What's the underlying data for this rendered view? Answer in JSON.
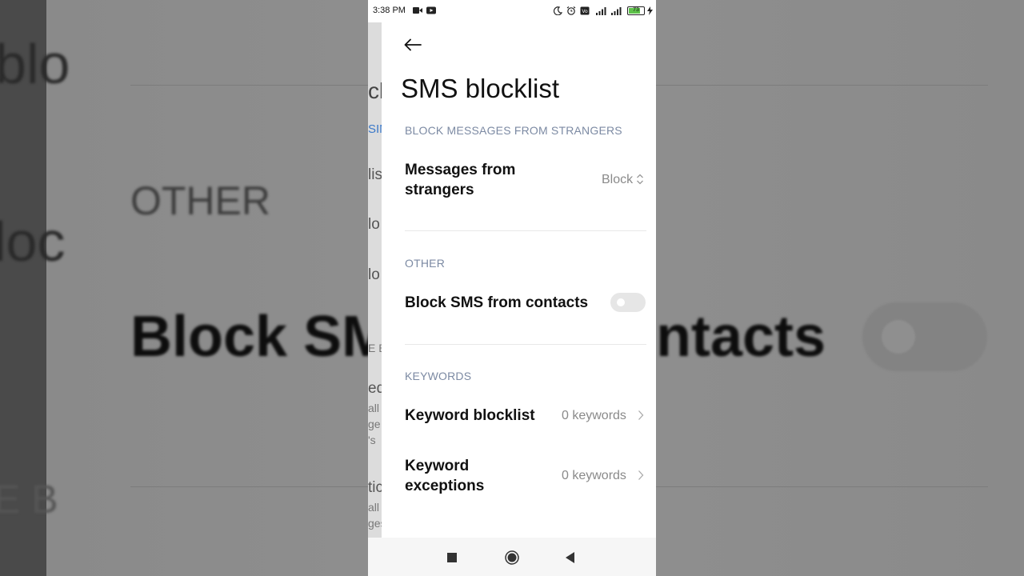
{
  "status_bar": {
    "time": "3:38 PM",
    "battery": "73"
  },
  "header": {
    "title": "SMS blocklist"
  },
  "sections": [
    {
      "header": "BLOCK MESSAGES FROM STRANGERS"
    },
    {
      "header": "OTHER"
    },
    {
      "header": "KEYWORDS"
    }
  ],
  "items": {
    "strangers": {
      "label_line1": "Messages from",
      "label_line2": "strangers",
      "value": "Block"
    },
    "contacts": {
      "label": "Block SMS from contacts",
      "toggle_on": false
    },
    "keyword_blocklist": {
      "label": "Keyword blocklist",
      "value": "0 keywords"
    },
    "keyword_exceptions": {
      "label_line1": "Keyword",
      "label_line2": "exceptions",
      "value": "0 keywords"
    }
  },
  "backdrop": {
    "left_top": "blo",
    "left_mid": "loc",
    "left_bot": "E B",
    "other": "OTHER",
    "big_left": "Block SM",
    "big_right": "ntacts"
  },
  "ghost": {
    "t1": "ck",
    "t2": "SIM",
    "t3": "lis",
    "t4": "lo",
    "t5": "lo",
    "t6": "E B",
    "t7": "ed",
    "t8": "all",
    "t9": "ge",
    "t10": "'s",
    "t11": "tic",
    "t12": "all",
    "t13": "ges"
  },
  "colors": {
    "accent_header": "#7c8aa3",
    "battery_fill": "#5ec24a"
  }
}
